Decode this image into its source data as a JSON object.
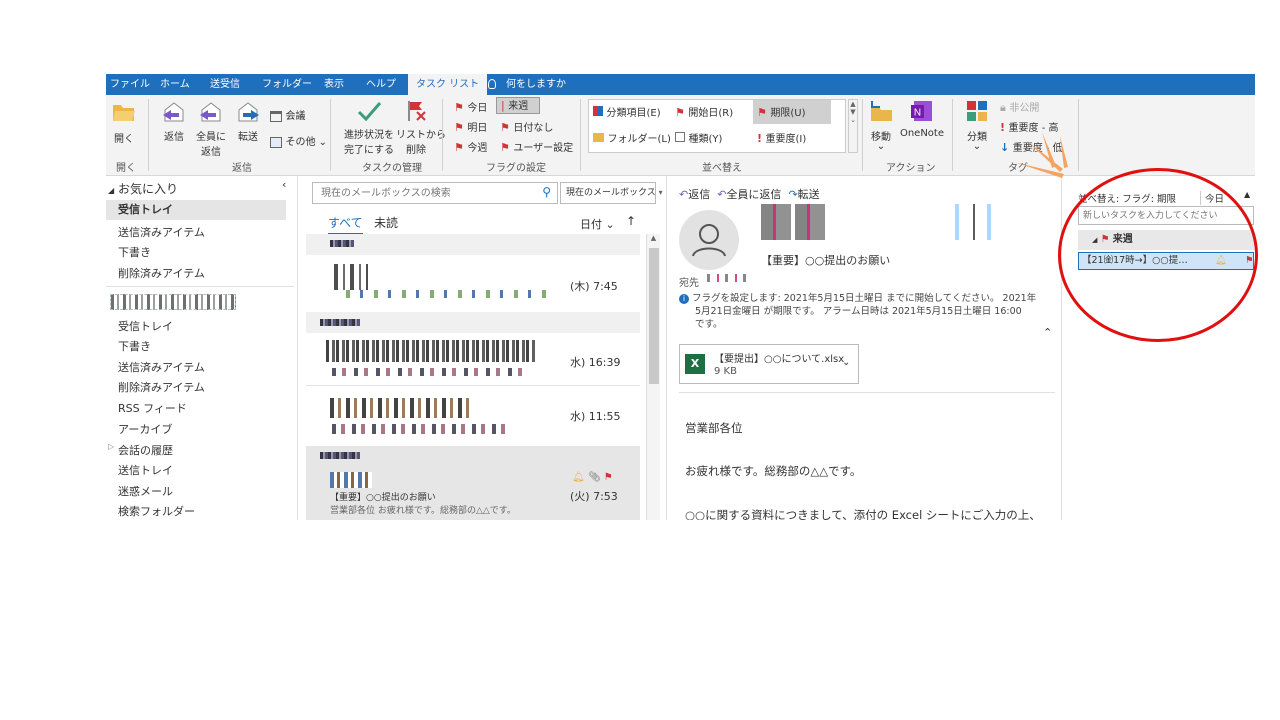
{
  "menubar": {
    "tabs": [
      "ファイル",
      "ホーム",
      "送受信",
      "フォルダー",
      "表示",
      "ヘルプ",
      "タスク リスト"
    ],
    "active_tab": "タスク リスト",
    "tell_me": "何をしますか"
  },
  "ribbon": {
    "open": "開く",
    "reply": "返信",
    "reply_all_1": "全員に",
    "reply_all_2": "返信",
    "forward": "転送",
    "meeting": "会議",
    "other": "その他 ⌄",
    "group_open": "開く",
    "group_reply": "返信",
    "progress_1": "進捗状況を",
    "progress_2": "完了にする",
    "remove_1": "リストから",
    "remove_2": "削除",
    "group_task": "タスクの管理",
    "today": "今日",
    "this_week_next": "来週",
    "tomorrow": "明日",
    "no_date": "日付なし",
    "this_week": "今週",
    "custom": "ユーザー設定",
    "group_flag": "フラグの設定",
    "category": "分類項目(E)",
    "start_date": "開始日(R)",
    "due_date": "期限(U)",
    "folder": "フォルダー(L)",
    "type": "種類(Y)",
    "importance": "重要度(I)",
    "group_sort": "並べ替え",
    "move": "移動",
    "onenote": "OneNote",
    "group_action": "アクション",
    "classify": "分類",
    "private": "非公開",
    "importance_high": "重要度 - 高",
    "importance_low": "重要度 - 低",
    "group_tag": "タグ"
  },
  "folders": {
    "favorites": "お気に入り",
    "fav_items": [
      "受信トレイ",
      "送信済みアイテム",
      "下書き",
      "削除済みアイテム"
    ],
    "account_items": [
      "受信トレイ",
      "下書き",
      "送信済みアイテム",
      "削除済みアイテム",
      "RSS フィード",
      "アーカイブ",
      "会話の履歴",
      "送信トレイ",
      "迷惑メール",
      "検索フォルダー"
    ]
  },
  "list": {
    "search_placeholder": "現在のメールボックスの検索",
    "scope": "現在のメールボックス",
    "filter_all": "すべて",
    "filter_unread": "未読",
    "sort_by": "日付 ⌄",
    "times": [
      "(木) 7:45",
      "水) 16:39",
      "水) 11:55",
      "(火) 7:53"
    ],
    "selected_subject": "【重要】○○提出のお願い",
    "selected_preview": "営業部各位  お疲れ様です。総務部の△△です。"
  },
  "reading": {
    "reply": "返信",
    "reply_all": "全員に返信",
    "forward": "転送",
    "subject": "【重要】○○提出のお願い",
    "to_label": "宛先",
    "flag_info_1": "フラグを設定します: 2021年5月15日土曜日 までに開始してください。 2021年",
    "flag_info_2": "5月21日金曜日 が期限です。 アラーム日時は 2021年5月15日土曜日 16:00",
    "flag_info_3": "です。",
    "attachment_name": "【要提出】○○について.xlsx",
    "attachment_size": "9 KB",
    "body_1": "営業部各位",
    "body_2": "お疲れ様です。総務部の△△です。",
    "body_3": "○○に関する資料につきまして、添付の Excel シートにご入力の上、"
  },
  "todo": {
    "sort_label": "並べ替え: フラグ: 期限",
    "today": "今日",
    "new_task_placeholder": "新しいタスクを入力してください",
    "group_next_week": "来週",
    "task_item": "【21㈮17時→】○○提…"
  },
  "colors": {
    "accent": "#1f6fbf",
    "flag_red": "#d13438",
    "highlight_circle": "#e01010",
    "burst": "#f4a460"
  }
}
